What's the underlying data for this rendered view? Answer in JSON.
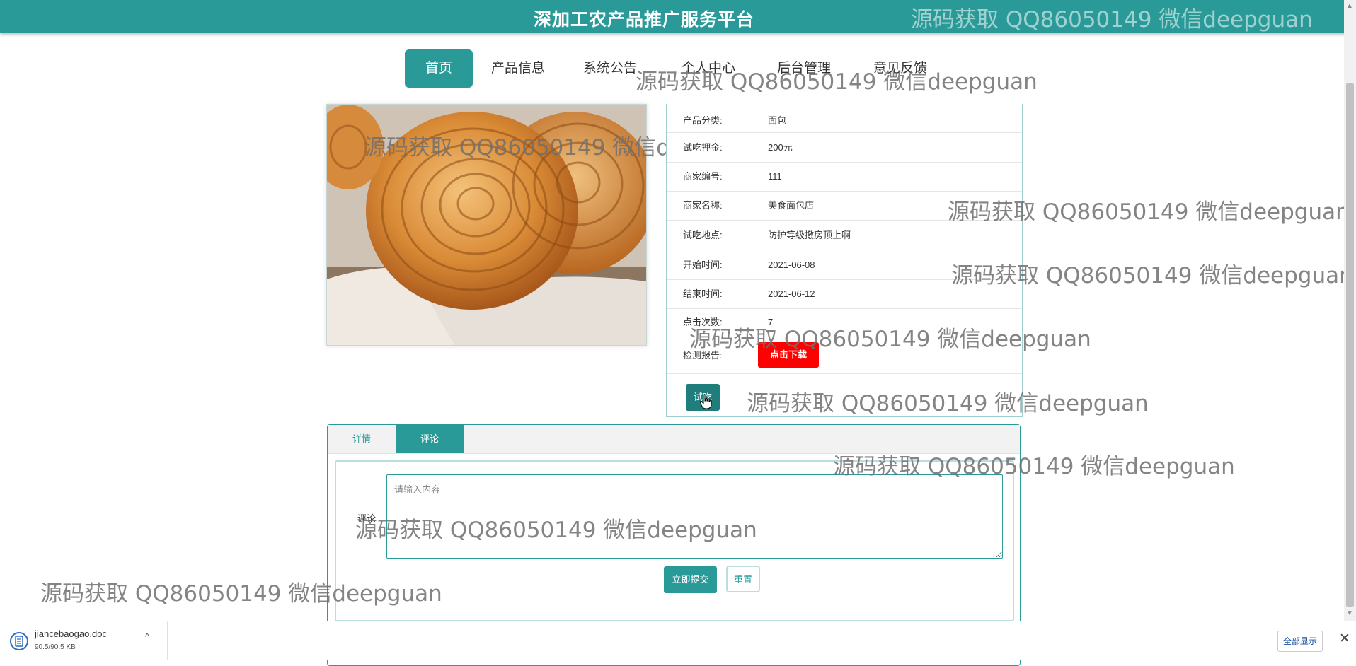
{
  "header": {
    "title": "深加工农产品推广服务平台"
  },
  "nav": {
    "items": [
      "首页",
      "产品信息",
      "系统公告",
      "个人中心",
      "后台管理",
      "意见反馈"
    ],
    "active_index": 0
  },
  "product": {
    "fields": [
      {
        "label": "产品分类:",
        "value": "面包"
      },
      {
        "label": "试吃押金:",
        "value": "200元"
      },
      {
        "label": "商家编号:",
        "value": "111"
      },
      {
        "label": "商家名称:",
        "value": "美食面包店"
      },
      {
        "label": "试吃地点:",
        "value": "防护等级撤房顶上啊"
      },
      {
        "label": "开始时间:",
        "value": "2021-06-08"
      },
      {
        "label": "结束时间:",
        "value": "2021-06-12"
      },
      {
        "label": "点击次数:",
        "value": "7"
      }
    ],
    "report_label": "检测报告:",
    "download_label": "点击下载",
    "trial_button": "试吃"
  },
  "tabs": {
    "items": [
      "详情",
      "评论"
    ],
    "active_index": 1
  },
  "comment": {
    "label": "评论",
    "placeholder": "请输入内容",
    "submit_label": "立即提交",
    "reset_label": "重置"
  },
  "watermark": {
    "text": "源码获取 QQ86050149 微信deepguan"
  },
  "download_bar": {
    "file_name": "jiancebaogao.doc",
    "file_size": "90.5/90.5 KB",
    "show_all": "全部显示"
  },
  "colors": {
    "primary": "#2a9a98",
    "download_button": "#ff0000"
  },
  "icons": {
    "file": "word-doc-icon",
    "close": "close-icon",
    "chevron": "chevron-up-icon",
    "cursor": "hand-pointer-icon"
  }
}
